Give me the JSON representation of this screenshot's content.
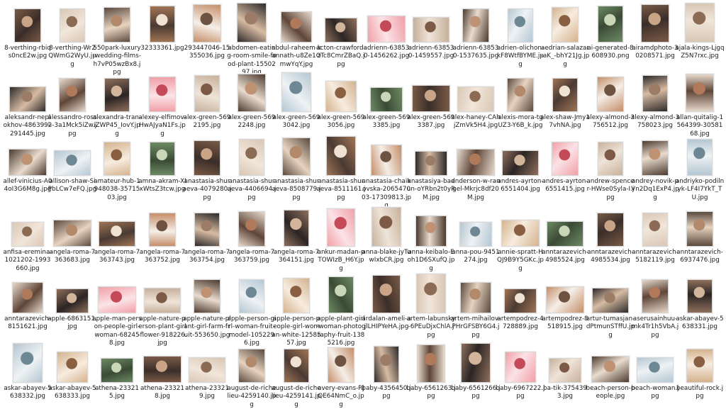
{
  "rows": [
    [
      "8-verthing-rbiqs0ncE2w.jpg",
      "8-verthing-Wr2QWmG2WyU.jpg",
      "550park-luxury-wedding-films-h7vP05wzBx8.jpg",
      "32333361.jpg",
      "293447046-15355036.jpg",
      "abdomen-eating-room-smile-food-plant-1550297.jpg",
      "abdul-raheem-kannath-u8Ze1OmwYqY.jpg",
      "acton-crawford-zTc8CmrZBaQ.jpg",
      "adrienn-638530-1456262.jpg",
      "adrienn-638530-1459557.jpg",
      "adrienn-638530-1537635.jpg",
      "adrien-olichon-kF8WtfBYME.jpg",
      "aedrian-salazar-aK_-bhY21Jg.jpg",
      "ai-generated-8608930.png",
      "airamdphoto-30208571.jpg",
      "ajala-kings-LjgqZ5N7rxc.jpg"
    ],
    [
      "aleksandr-neplokhov-4863992291445.jpg",
      "alessandro-rossi--3a1Mck5iZw.jpg",
      "alexandra-tran-iZWP45_IovY.jpg",
      "alexey-elfimov-HwAJyaN1Fs.jpg",
      "alex-green-5692195.jpg",
      "alex-green-5692248.jpg",
      "alex-green-5693042.jpg",
      "alex-green-5693056.jpg",
      "alex-green-5693385.jpg",
      "alex-green-5693387.jpg",
      "alex-haney-CAhjZmVk5H4.jpg",
      "alexis-mora-tgUZ3-Y6B_k.jpg",
      "alex-shaw-Jmy17vhNA.jpg",
      "alexy-almond-3756512.jpg",
      "alexy-almond-3758023.jpg",
      "allan-quitalig-1564399-3058168.jpg"
    ],
    [
      "allef-vinicius-A04oI3G6M8g.jpg",
      "allison-shaw-SiPbLCw7eFQ.jpg",
      "amateur-hub-1948038-3571503.jpg",
      "amna-akram-XIxWtsZ3tcw.jpg",
      "anastasia-shuraeva-4079280.jpg",
      "anastasia-shuraeva-4406694.jpg",
      "anastasia-shuraeva-8508779.jpg",
      "anastasia-shuraeva-8511161.jpg",
      "anastasia-chaikovska-2065470 03-17309813.jpg",
      "anastasiya-badun-oYRbn2t0yRM.jpg",
      "anderson-w-rangel-Mkrjc8df20M.jpg",
      "andres-ayrton-6551404.jpg",
      "andres-ayrton-6551415.jpg",
      "andrew-spencer-HWse0Syla-I.jpg",
      "andrey-novik-pVn2Dq1ExP4.jpg",
      "andriyko-podilnyk-LF4I7YkT_TU.jpg"
    ],
    [
      "anfisa-eremina-1021202-1993660.jpg",
      "angela-roma-7363683.jpg",
      "angela-roma-7363743.jpg",
      "angela-roma-7363752.jpg",
      "angela-roma-7363754.jpg",
      "angela-roma-7363759.jpg",
      "angela-roma-7364151.jpg",
      "ankur-madan-pTOWIzB_H6Y.jpg",
      "anna-blake-jyTuwIxbCR.jpg",
      "anna-keibalo-Eoh1D6SXufQ.jpg",
      "anna-pou-9451274.jpg",
      "annie-spratt-HQJ9B9Y5GKc.jpg",
      "anntarazevich-4985524.jpg",
      "anntarazevich-4985534.jpg",
      "anntarazevich-5182119.jpg",
      "anntarazevich-6937476.jpg"
    ],
    [
      "anntarazevich-8151621.jpg",
      "apple-6863151.jpg",
      "apple-man-person-people-girl-woman-682458.jpg",
      "apple-nature-person-plant-girl-flower-918226.jpg",
      "apple-nature-plant-girl-farm-fruit-553650.jpg",
      "apple-person-girl-woman-fruit-model-1052296.jpg",
      "apple-person-people-girl-woman-white-1258557.jpg",
      "apple-plant-girl-woman-photography-fruit-1385216.jpg",
      "ardalan-ameli-ajlLHIPYeHA.jpg",
      "artem-labunsky-6PEuDjxChlA.jpg",
      "artem-mihailov-PHrGFSBY6G4.jpg",
      "artempodrez-4728889.jpg",
      "artempodrez-8518915.jpg",
      "artur-tumasjan-dPtmunSTffU.jpg",
      "aserusainhuu-mk4Tr1h5VbA.jpg",
      "askar-abayev-5638331.jpg"
    ],
    [
      "askar-abayev-5638332.jpg",
      "askar-abayev-5638333.jpg",
      "athena-233215.jpg",
      "athena-233218.jpg",
      "athena-233219.jpg",
      "august-de-richelieu-4259140.jpg",
      "august-de-richelieu-4259141.jpg",
      "avery-evans-RJQE64NmC_o.jpg",
      "baby-4356450.jpg",
      "baby-6561263.jpg",
      "baby-6561266.jpg",
      "baby-6967222.jpg",
      "ba-tik-3754393.jpg",
      "beach-person-people.jpg",
      "beach-woman.jpg",
      "beautiful-rock.jpg"
    ]
  ]
}
